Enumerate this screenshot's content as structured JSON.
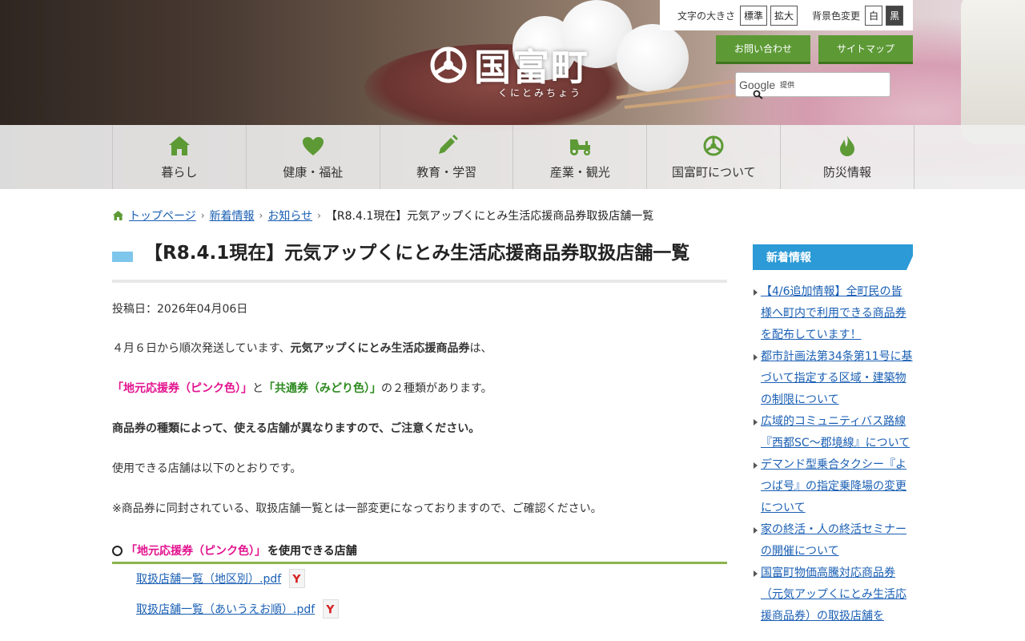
{
  "header": {
    "logo_text": "国富町",
    "logo_kana": "くにとみちょう",
    "font_size_label": "文字の大きさ",
    "font_standard": "標準",
    "font_large": "拡大",
    "bg_color_label": "背景色変更",
    "bg_white": "白",
    "bg_black": "黒",
    "contact_button": "お問い合わせ",
    "sitemap_button": "サイトマップ",
    "search_brand": "Google",
    "search_sub": "提供"
  },
  "nav": {
    "items": [
      {
        "label": "暮らし",
        "icon": "home-icon"
      },
      {
        "label": "健康・福祉",
        "icon": "heart-icon"
      },
      {
        "label": "教育・学習",
        "icon": "pencil-icon"
      },
      {
        "label": "産業・観光",
        "icon": "tractor-icon"
      },
      {
        "label": "国富町について",
        "icon": "town-emblem-icon"
      },
      {
        "label": "防災情報",
        "icon": "fire-icon"
      }
    ]
  },
  "breadcrumb": {
    "home": "トップページ",
    "level1": "新着情報",
    "level2": "お知らせ",
    "current": "【R8.4.1現在】元気アップくにとみ生活応援商品券取扱店舗一覧"
  },
  "article": {
    "title": "【R8.4.1現在】元気アップくにとみ生活応援商品券取扱店舗一覧",
    "posted": "投稿日：2026年04月06日",
    "p1_pre": "４月６日から順次発送しています、",
    "p1_bold": "元気アップくにとみ生活応援商品券",
    "p1_post": "は、",
    "p2_pink": "「地元応援券（ピンク色）」",
    "p2_mid": "と",
    "p2_green": "「共通券（みどり色）」",
    "p2_post": "の２種類があります。",
    "p3": "商品券の種類によって、使える店舗が異なりますので、ご注意ください。",
    "p4": "使用できる店舗は以下のとおりです。",
    "p5": "※商品券に同封されている、取扱店舗一覧とは一部変更になっておりますので、ご確認ください。",
    "section1_pink": "「地元応援券（ピンク色）」",
    "section1_post": "を使用できる店舗",
    "file1": "取扱店舗一覧（地区別）.pdf",
    "file2": "取扱店舗一覧（あいうえお順）.pdf"
  },
  "sidebar": {
    "heading": "新着情報",
    "items": [
      "【4/6追加情報】全町民の皆様へ町内で利用できる商品券を配布しています！",
      "都市計画法第34条第11号に基づいて指定する区域・建築物の制限について",
      "広域的コミュニティバス路線『西都SC～郡境線』について",
      "デマンド型乗合タクシー『よつば号』の指定乗降場の変更について",
      "家の終活・人の終活セミナーの開催について",
      "国富町物価高騰対応商品券（元気アップくにとみ生活応援商品券）の取扱店舗を"
    ]
  },
  "colors": {
    "brand_green": "#5d9a36",
    "link_blue": "#1a5fb4",
    "side_head_blue": "#2b9ad6",
    "pink_text": "#e3128f",
    "green_text": "#2c8a1f"
  }
}
